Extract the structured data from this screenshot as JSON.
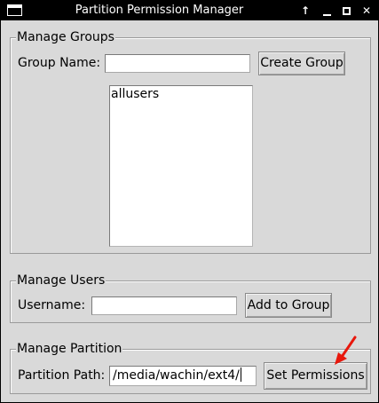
{
  "window": {
    "title": "Partition Permission Manager",
    "controls": {
      "up_icon": "arrow-up-icon",
      "minimize_icon": "minimize-icon",
      "maximize_icon": "maximize-icon",
      "close_icon": "close-icon",
      "up_glyph": "↑",
      "close_glyph": "✕"
    }
  },
  "groups": {
    "legend": "Manage Groups",
    "name_label": "Group Name:",
    "name_value": "",
    "create_label": "Create Group",
    "list": [
      "allusers"
    ]
  },
  "users": {
    "legend": "Manage Users",
    "username_label": "Username:",
    "username_value": "",
    "add_label": "Add to Group"
  },
  "partition": {
    "legend": "Manage Partition",
    "path_label": "Partition Path:",
    "path_value": "/media/wachin/ext4/",
    "set_label": "Set Permissions"
  },
  "annotation": {
    "arrow_color": "#e8170c"
  }
}
